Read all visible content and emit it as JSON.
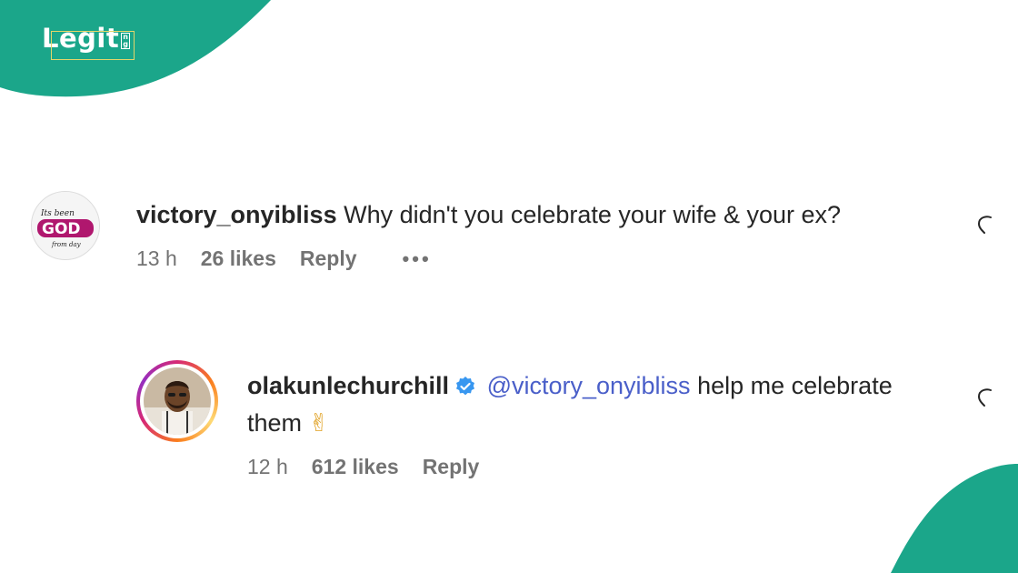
{
  "brand": {
    "logo_text": "Legit",
    "logo_tld_top": "n",
    "logo_tld_bottom": "g",
    "accent_color": "#1ba68a"
  },
  "comments": [
    {
      "username": "victory_onyibliss",
      "text": "Why didn't you celebrate your wife & your ex?",
      "time": "13 h",
      "likes": "26 likes",
      "reply_label": "Reply",
      "more_label": "•••",
      "avatar_icon": "avatar-logo-god"
    },
    {
      "username": "olakunlechurchill",
      "verified": true,
      "mention": "@victory_onyibliss",
      "text": "help me celebrate them",
      "emoji": "✌",
      "time": "12 h",
      "likes": "612 likes",
      "reply_label": "Reply",
      "avatar_icon": "avatar-photo-man"
    }
  ]
}
